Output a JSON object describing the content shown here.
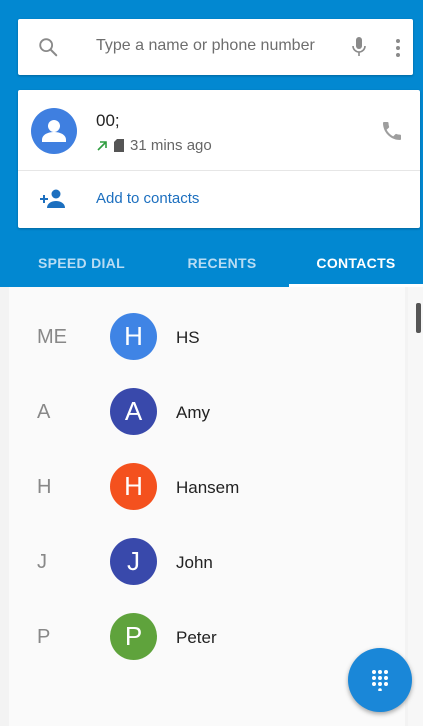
{
  "search": {
    "placeholder": "Type a name or phone number"
  },
  "recent": {
    "name": "00;",
    "time": "31 mins ago",
    "add_to_contacts": "Add to contacts"
  },
  "tabs": [
    {
      "label": "SPEED DIAL",
      "active": false
    },
    {
      "label": "RECENTS",
      "active": false
    },
    {
      "label": "CONTACTS",
      "active": true
    }
  ],
  "contacts": [
    {
      "section": "ME",
      "initial": "H",
      "name": "HS",
      "color": "#3f84e5"
    },
    {
      "section": "A",
      "initial": "A",
      "name": "Amy",
      "color": "#3949ab"
    },
    {
      "section": "H",
      "initial": "H",
      "name": "Hansem",
      "color": "#f4511e"
    },
    {
      "section": "J",
      "initial": "J",
      "name": "John",
      "color": "#3949ab"
    },
    {
      "section": "P",
      "initial": "P",
      "name": "Peter",
      "color": "#5fa33c"
    }
  ],
  "colors": {
    "accent": "#0288d1",
    "fab": "#1a87d8"
  },
  "icons": [
    "search-icon",
    "mic-icon",
    "more-vert-icon",
    "person-icon",
    "outgoing-call-icon",
    "sim-icon",
    "phone-icon",
    "add-person-icon",
    "dialpad-icon"
  ]
}
